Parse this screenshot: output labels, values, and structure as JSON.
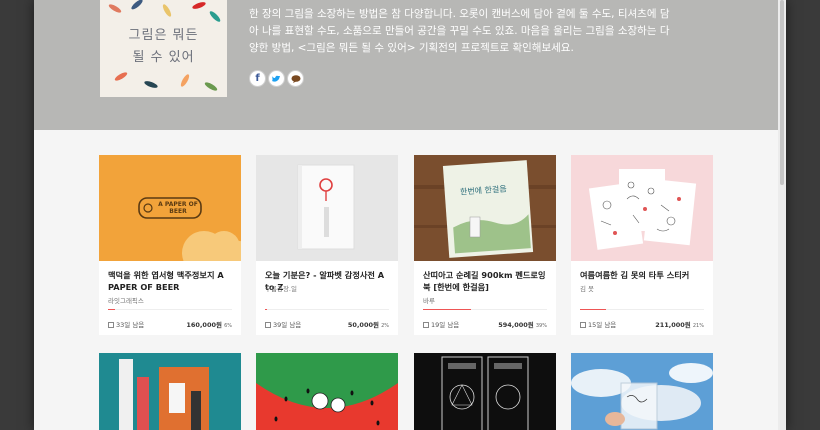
{
  "hero": {
    "poster_line1": "그림은 뭐든",
    "poster_line2": "될 수 있어",
    "description": "한 장의 그림을 소장하는 방법은 참 다양합니다. 오롯이 캔버스에 담아 곁에 둘 수도, 티셔츠에 담아 나를 표현할 수도, 소품으로 만들어 공간을 꾸밀 수도 있죠. 마음을 울리는 그림을 소장하는 다양한 방법, <그림은 뭐든 될 수 있어> 기획전의 프로젝트로 확인해보세요.",
    "share_icons": [
      "facebook-icon",
      "twitter-icon",
      "kakaostory-icon"
    ],
    "bg_color": "#b7b7b5"
  },
  "projects": [
    {
      "title": "맥덕을 위한 엽서형 맥주정보지 A PAPER OF BEER",
      "creator": "라잇그래픽스",
      "days_left": "33일 남음",
      "amount": "160,000원",
      "percent": "6%",
      "progress": 0.06,
      "image_text": "A PAPER OF BEER"
    },
    {
      "title": "오늘 기분은? - 알파벳 감정사전 A to Z",
      "creator": "구름공장.일",
      "days_left": "39일 남음",
      "amount": "50,000원",
      "percent": "2%",
      "progress": 0.02,
      "image_text": ""
    },
    {
      "title": "산띠아고 순례길 900km 펜드로잉 북 [한번에 한걸음]",
      "creator": "바루",
      "days_left": "19일 남음",
      "amount": "594,000원",
      "percent": "39%",
      "progress": 0.39,
      "image_text": "한번에 한걸음"
    },
    {
      "title": "여름여름한 김 못의 타투 스티커",
      "creator": "김 못",
      "days_left": "15일 남음",
      "amount": "211,000원",
      "percent": "21%",
      "progress": 0.21,
      "image_text": ""
    }
  ],
  "colors": {
    "progress": "#e55a5a",
    "beer_orange": "#f2a33a",
    "watermelon": "#e8392e"
  }
}
